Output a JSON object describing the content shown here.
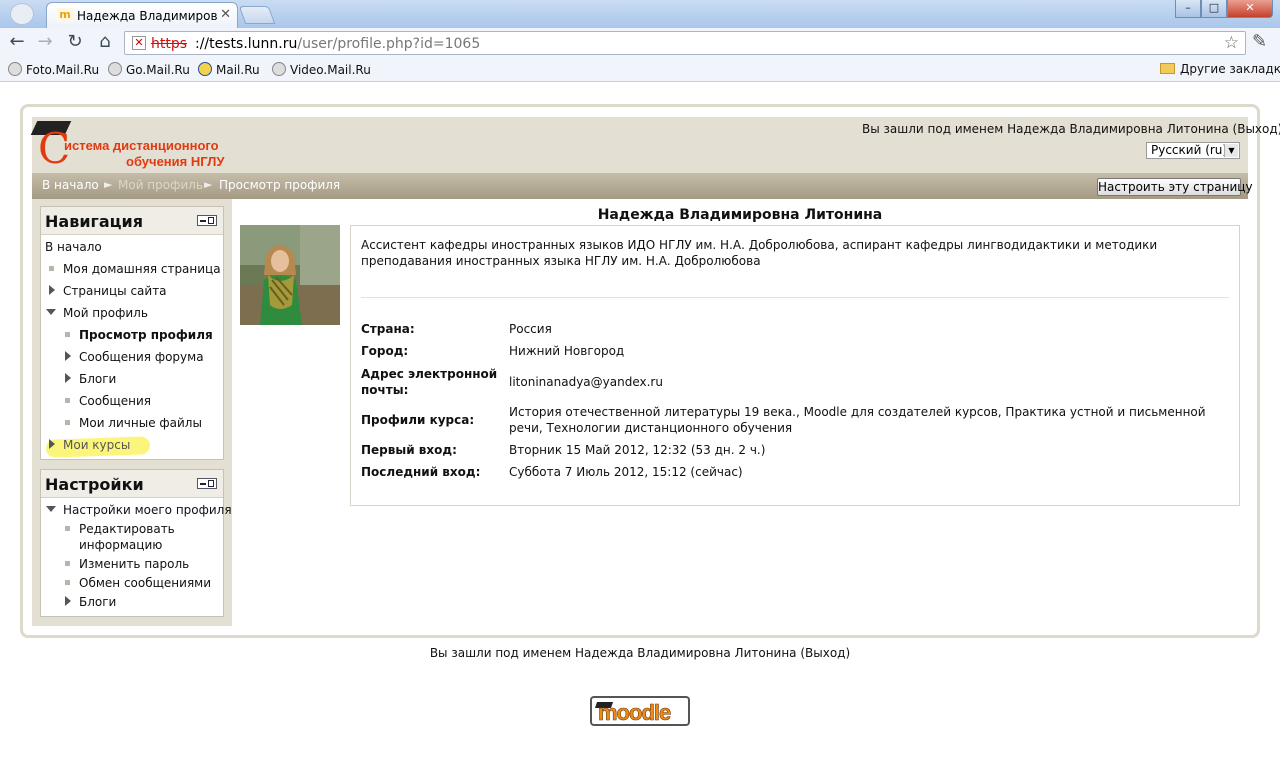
{
  "browser": {
    "tab_title": "Надежда Владимировна Л",
    "favicon_text": "m",
    "url_scheme": "https",
    "url_host": "://tests.lunn.ru",
    "url_path": "/user/profile.php?id=1065",
    "bookmarks": [
      {
        "label": "Foto.Mail.Ru"
      },
      {
        "label": "Go.Mail.Ru"
      },
      {
        "label": "Mail.Ru"
      },
      {
        "label": "Video.Mail.Ru"
      }
    ],
    "other_bookmarks": "Другие закладки",
    "controls": {
      "minimize": "–",
      "maximize": "□",
      "close": "✕"
    }
  },
  "site": {
    "logo_line1": "истема дистанционного",
    "logo_line2": "обучения НГЛУ",
    "logo_initial": "С",
    "login_text": "Вы зашли под именем Надежда Владимировна Литонина (Выход)",
    "language": "Русский (ru)"
  },
  "breadcrumb": {
    "home": "В начало",
    "my_profile": "Мой профиль",
    "current": "Просмотр профиля",
    "separator": "►"
  },
  "edit_page_button": "Настроить эту страницу",
  "navigation": {
    "title": "Навигация",
    "home": "В начало",
    "my_home": "Моя домашняя страница",
    "site_pages": "Страницы сайта",
    "my_profile": "Мой профиль",
    "view_profile": "Просмотр профиля",
    "forum_posts": "Сообщения форума",
    "blogs": "Блоги",
    "messages": "Сообщения",
    "private_files": "Мои личные файлы",
    "my_courses": "Мои курсы"
  },
  "settings": {
    "title": "Настройки",
    "profile_settings": "Настройки моего профиля",
    "edit_profile_l1": "Редактировать",
    "edit_profile_l2": "информацию",
    "change_password": "Изменить пароль",
    "messaging": "Обмен сообщениями",
    "blogs": "Блоги"
  },
  "profile": {
    "name": "Надежда Владимировна Литонина",
    "description": "Ассистент кафедры иностранных языков ИДО НГЛУ им. Н.А. Добролюбова, аспирант кафедры лингводидактики и методики преподавания иностранных языка НГЛУ им. Н.А. Добролюбова",
    "fields": {
      "country_label": "Страна:",
      "country": "Россия",
      "city_label": "Город:",
      "city": "Нижний Новгород",
      "email_label_l1": "Адрес электронной",
      "email_label_l2": "почты:",
      "email": "litoninanadya@yandex.ru",
      "courses_label": "Профили курса:",
      "courses": "История отечественной литературы 19 века., Moodle для создателей курсов, Практика устной и письменной речи, Технологии дистанционного обучения",
      "first_access_label": "Первый вход:",
      "first_access": "Вторник 15 Май 2012, 12:32  (53 дн. 2 ч.)",
      "last_access_label": "Последний вход:",
      "last_access": "Суббота 7 Июль 2012, 15:12  (сейчас)"
    }
  },
  "footer": {
    "login_text": "Вы зашли под именем Надежда Владимировна Литонина (Выход)",
    "moodle_logo": "moodle"
  },
  "colors": {
    "brand_orange": "#e13a11",
    "header_bg": "#e4dfd3",
    "highlight": "#fbf56d",
    "moodle_orange": "#f08a16"
  }
}
